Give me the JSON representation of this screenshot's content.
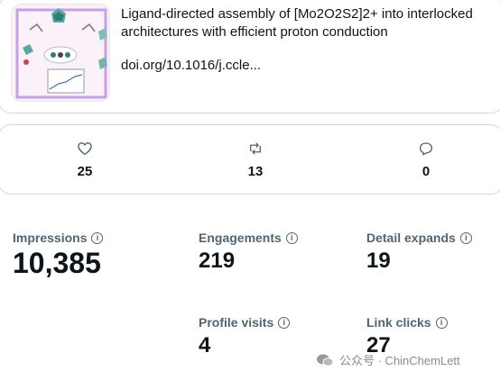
{
  "link_card": {
    "title": "Ligand-directed assembly of [Mo2O2S2]2+ into interlocked architectures with efficient proton conduction",
    "url": "doi.org/10.1016/j.ccle..."
  },
  "actions": {
    "likes": "25",
    "reposts": "13",
    "replies": "0"
  },
  "metrics": {
    "impressions": {
      "label": "Impressions",
      "value": "10,385"
    },
    "engagements": {
      "label": "Engagements",
      "value": "219"
    },
    "detail_expands": {
      "label": "Detail expands",
      "value": "19"
    },
    "profile_visits": {
      "label": "Profile visits",
      "value": "4"
    },
    "link_clicks": {
      "label": "Link clicks",
      "value": "27"
    }
  },
  "watermark": {
    "text": "公众号 · ChinChemLett"
  },
  "colors": {
    "text": "#0f1419",
    "muted": "#536471",
    "border": "#cfd9de"
  }
}
